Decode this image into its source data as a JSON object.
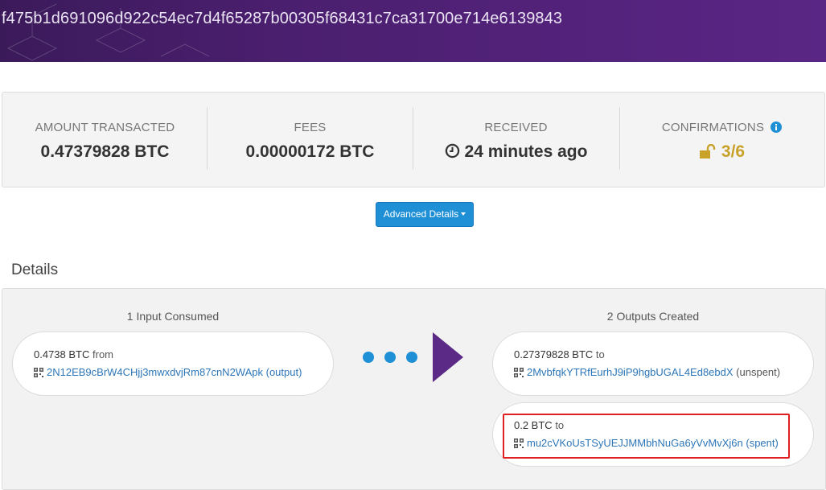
{
  "header": {
    "tx_hash": "f475b1d691096d922c54ec7d4f65287b00305f68431c7ca31700e714e6139843"
  },
  "summary": {
    "amount": {
      "label": "AMOUNT TRANSACTED",
      "value": "0.47379828 BTC"
    },
    "fees": {
      "label": "FEES",
      "value": "0.00000172 BTC"
    },
    "received": {
      "label": "RECEIVED",
      "value": "24 minutes ago"
    },
    "confirmations": {
      "label": "CONFIRMATIONS",
      "value": "3/6"
    }
  },
  "advanced_button": {
    "label": "Advanced Details"
  },
  "details": {
    "title": "Details",
    "inputs_title": "1 Input Consumed",
    "outputs_title": "2 Outputs Created",
    "inputs": [
      {
        "amount": "0.4738 BTC",
        "dir": "from",
        "address": "2N12EB9cBrW4CHjj3mwxdvjRm87cnN2WApk",
        "note": "(output)"
      }
    ],
    "outputs": [
      {
        "amount": "0.27379828 BTC",
        "dir": "to",
        "address": "2MvbfqkYTRfEurhJ9iP9hgbUGAL4Ed8ebdX",
        "note": "(unspent)"
      },
      {
        "amount": "0.2 BTC",
        "dir": "to",
        "address": "mu2cVKoUsTSyUEJJMMbhNuGa6yVvMvXj6n",
        "note": "(spent)"
      }
    ]
  },
  "colors": {
    "header": "#4b1f6f",
    "accent": "#1f8fd6",
    "confirm": "#c9a22a",
    "arrow": "#5b2a86",
    "highlight": "#e02020"
  }
}
